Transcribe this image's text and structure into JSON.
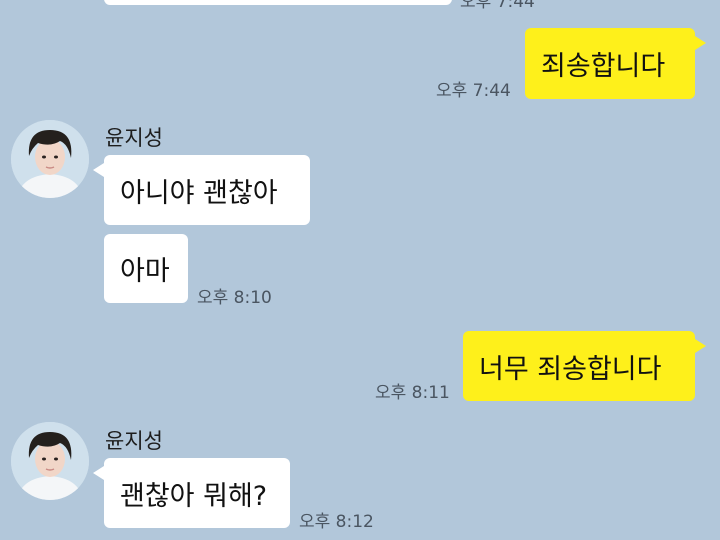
{
  "chat": {
    "cut_top_time": "오후 7:44",
    "msgs": [
      {
        "text": "죄송합니다",
        "time": "오후 7:44",
        "sender": "me"
      },
      {
        "sender": "윤지성",
        "text": "아니야 괜찮아"
      },
      {
        "text": "아마",
        "time": "오후 8:10"
      },
      {
        "text": "너무 죄송합니다",
        "time": "오후 8:11",
        "sender": "me"
      },
      {
        "sender": "윤지성",
        "text": "괜찮아 뭐해?",
        "time": "오후 8:12"
      }
    ]
  },
  "colors": {
    "background": "#b2c7da",
    "my_bubble": "#fef01b",
    "their_bubble": "#ffffff"
  }
}
